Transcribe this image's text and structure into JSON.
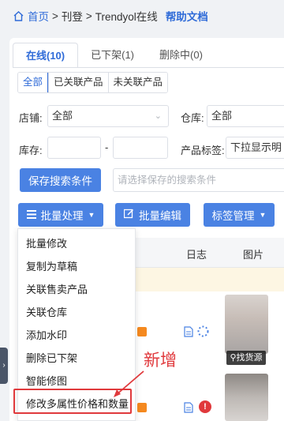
{
  "breadcrumb": {
    "home": "首页",
    "sep1": ">",
    "level1": "刊登",
    "sep2": ">",
    "current": "Trendyol在线",
    "help": "帮助文档"
  },
  "tabs": [
    {
      "label": "在线(10)",
      "active": true
    },
    {
      "label": "已下架(1)",
      "active": false
    },
    {
      "label": "删除中(0)",
      "active": false
    }
  ],
  "segment": [
    "全部",
    "已关联产品",
    "未关联产品"
  ],
  "filters": {
    "store_label": "店铺:",
    "store_value": "全部",
    "warehouse_label": "仓库:",
    "warehouse_value": "全部",
    "stock_label": "库存:",
    "stock_dash": "-",
    "tag_label": "产品标签:",
    "tag_placeholder": "下拉显示明"
  },
  "actions": {
    "save_search": "保存搜索条件",
    "saved_placeholder": "请选择保存的搜索条件",
    "batch_process": "批量处理",
    "batch_edit": "批量编辑",
    "tag_manage": "标签管理"
  },
  "table": {
    "col_log": "日志",
    "col_image": "图片",
    "find_source": "找货源"
  },
  "menu": [
    "批量修改",
    "复制为草稿",
    "关联售卖产品",
    "关联仓库",
    "添加水印",
    "删除已下架",
    "智能修图",
    "修改多属性价格和数量"
  ],
  "annotation": "新增",
  "colors": {
    "primary": "#4a82e3",
    "link": "#2f6bd8",
    "highlight": "#e0393c",
    "orange": "#f5891f"
  }
}
